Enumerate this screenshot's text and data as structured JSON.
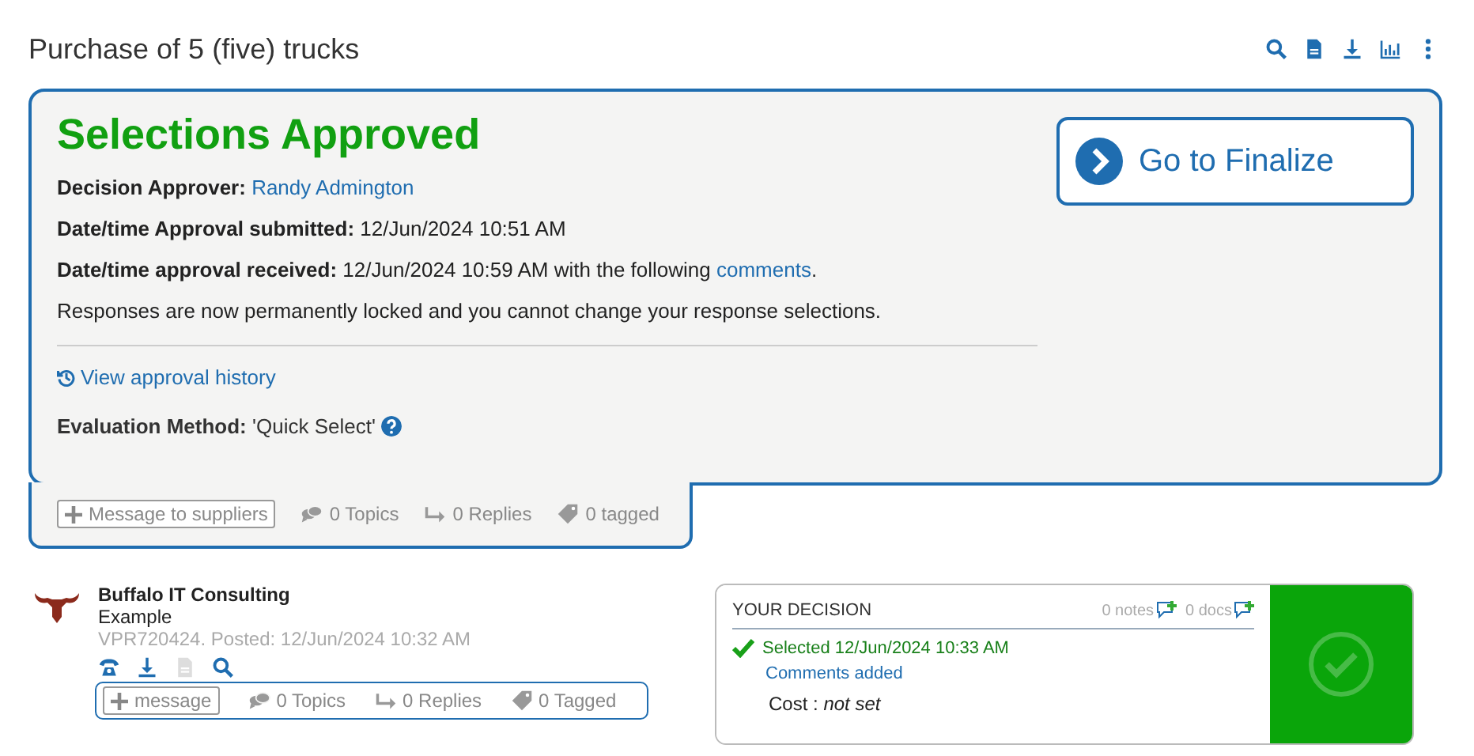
{
  "title": "Purchase of 5 (five) trucks",
  "toolbar": [
    {
      "kind": "search"
    },
    {
      "kind": "document"
    },
    {
      "kind": "download"
    },
    {
      "kind": "chart"
    },
    {
      "kind": "more"
    }
  ],
  "approval": {
    "heading": "Selections Approved",
    "lines": [
      {
        "label": "Decision Approver:",
        "link": "Randy Admington"
      },
      {
        "label": "Date/time Approval submitted:",
        "text": "12/Jun/2024 10:51 AM"
      },
      {
        "label": "Date/time approval received:",
        "text": "12/Jun/2024 10:59 AM with the following",
        "link": "comments",
        "after": "."
      },
      {
        "text": "Responses are now permanently locked and you cannot change your response selections."
      }
    ],
    "history_link": "View approval history",
    "method_label": "Evaluation Method:",
    "method_value": "'Quick Select'",
    "finalize_button": "Go to Finalize"
  },
  "panel_footer": {
    "message_button": "Message to suppliers",
    "stats": [
      {
        "kind": "topics",
        "label": "0 Topics"
      },
      {
        "kind": "replies",
        "label": "0 Replies"
      },
      {
        "kind": "tagged",
        "label": "0 tagged"
      }
    ]
  },
  "supplier": {
    "name": "Buffalo IT Consulting",
    "subtitle": "Example",
    "meta": "VPR720424. Posted: 12/Jun/2024 10:32 AM",
    "actions": [
      {
        "kind": "phone",
        "disabled": false
      },
      {
        "kind": "download",
        "disabled": false
      },
      {
        "kind": "document",
        "disabled": true
      },
      {
        "kind": "search",
        "disabled": false
      }
    ],
    "message_button": "message",
    "stats": [
      {
        "kind": "topics",
        "label": "0 Topics"
      },
      {
        "kind": "replies",
        "label": "0 Replies"
      },
      {
        "kind": "tagged",
        "label": "0 Tagged"
      }
    ]
  },
  "decision": {
    "heading": "YOUR DECISION",
    "notes": "0 notes",
    "docs": "0 docs",
    "selected": true,
    "status": "Selected 12/Jun/2024 10:33 AM",
    "comments": "Comments added",
    "cost_label": "Cost :",
    "cost_value": "not set"
  }
}
